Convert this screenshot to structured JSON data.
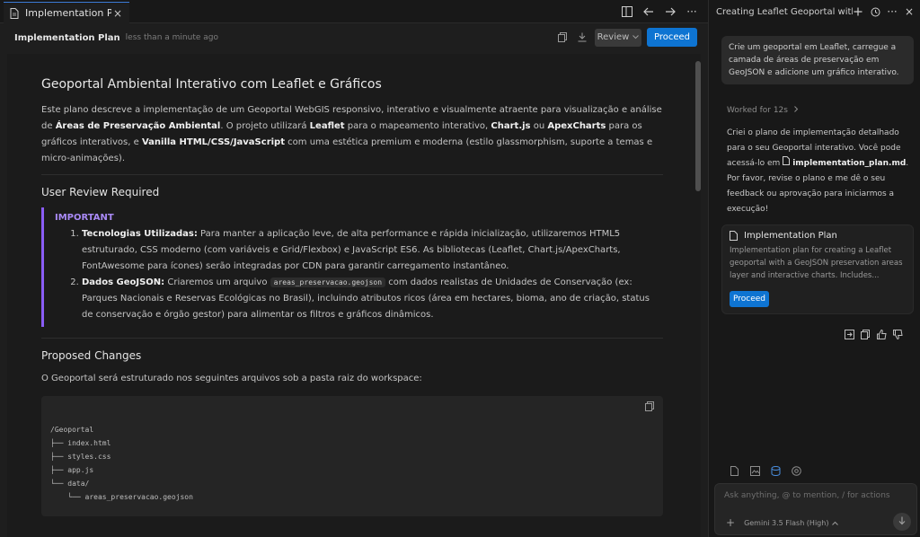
{
  "tab": {
    "label": "Implementation Plan",
    "close": "×"
  },
  "toolbar": {
    "more": "···"
  },
  "doc_header": {
    "title": "Implementation Plan",
    "time": "less than a minute ago",
    "review_label": "Review",
    "proceed_label": "Proceed"
  },
  "doc": {
    "title": "Geoportal Ambiental Interativo com Leaflet e Gráficos",
    "intro": {
      "t1": "Este plano descreve a implementação de um Geoportal WebGIS responsivo, interativo e visualmente atraente para visualização e análise de ",
      "b1": "Áreas de Preservação Ambiental",
      "t2": ". O projeto utilizará ",
      "b2": "Leaflet",
      "t3": " para o mapeamento interativo, ",
      "b3": "Chart.js",
      "t4": " ou ",
      "b4": "ApexCharts",
      "t5": " para os gráficos interativos, e ",
      "b5": "Vanilla HTML/CSS/JavaScript",
      "t6": " com uma estética premium e moderna (estilo glassmorphism, suporte a temas e micro-animações)."
    },
    "review_heading": "User Review Required",
    "important_label": "IMPORTANT",
    "items": [
      {
        "bold": "Tecnologias Utilizadas:",
        "text": " Para manter a aplicação leve, de alta performance e rápida inicialização, utilizaremos HTML5 estruturado, CSS moderno (com variáveis e Grid/Flexbox) e JavaScript ES6. As bibliotecas (Leaflet, Chart.js/ApexCharts, FontAwesome para ícones) serão integradas por CDN para garantir carregamento instantâneo."
      },
      {
        "bold": "Dados GeoJSON:",
        "text_before": " Criaremos um arquivo ",
        "code": "areas_preservacao.geojson",
        "text_after": " com dados realistas de Unidades de Conservação (ex: Parques Nacionais e Reservas Ecológicas no Brasil), incluindo atributos ricos (área em hectares, bioma, ano de criação, status de conservação e órgão gestor) para alimentar os filtros e gráficos dinâmicos."
      }
    ],
    "changes_heading": "Proposed Changes",
    "changes_text": "O Geoportal será estruturado nos seguintes arquivos sob a pasta raiz do workspace:",
    "code_lines": [
      "/Geoportal",
      "├── index.html",
      "├── styles.css",
      "├── app.js",
      "└── data/",
      "    └── areas_preservacao.geojson"
    ]
  },
  "chat": {
    "title": "Creating Leaflet Geoportal with C",
    "user_message": "Crie um geoportal em Leaflet, carregue a camada de áreas de preservação em GeoJSON e adicione um gráfico interativo.",
    "worked": "Worked for 12s",
    "reply_before": "Criei o plano de implementação detalhado para o seu Geoportal interativo. Você pode acessá-lo em ",
    "reply_file": "implementation_plan.md",
    "reply_after": ". Por favor, revise o plano e me dê o seu feedback ou aprovação para iniciarmos a execução!",
    "card_title": "Implementation Plan",
    "card_desc": "Implementation plan for creating a Leaflet geoportal with a GeoJSON preservation areas layer and interactive charts. Includes...",
    "card_proceed": "Proceed",
    "input_placeholder": "Ask anything, @ to mention, / for actions",
    "model": "Gemini 3.5 Flash (High)",
    "add": "+"
  }
}
